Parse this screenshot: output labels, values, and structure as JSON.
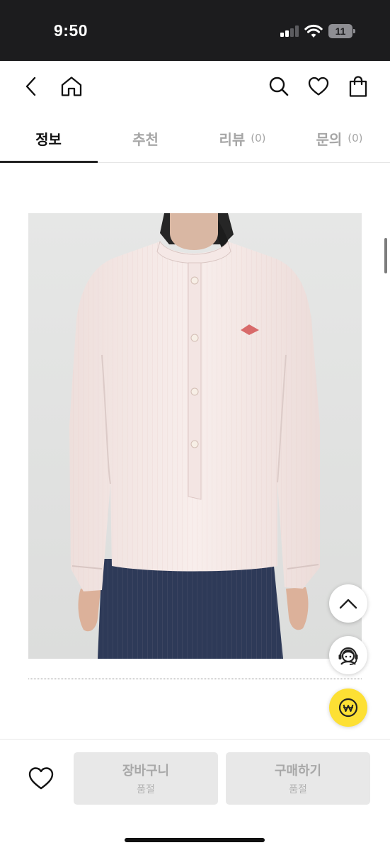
{
  "status_bar": {
    "time": "9:50",
    "battery_level": "11",
    "icons": [
      "cellular-signal-icon",
      "wifi-icon",
      "battery-icon"
    ]
  },
  "header": {
    "icons": [
      "back-arrow-icon",
      "home-icon",
      "search-icon",
      "heart-icon",
      "shopping-bag-icon"
    ]
  },
  "tabs": [
    {
      "label": "정보",
      "count": "",
      "active": true
    },
    {
      "label": "추천",
      "count": ""
    },
    {
      "label": "리뷰",
      "count": "(0)"
    },
    {
      "label": "문의",
      "count": "(0)"
    }
  ],
  "floating_buttons": {
    "icons": [
      "chevron-up-icon",
      "customer-service-icon",
      "won-pay-icon"
    ],
    "pay_color": "#FDE034"
  },
  "bottom_bar": {
    "wish_icon": "heart-outline-icon",
    "cart": {
      "label": "장바구니",
      "sub": "품절"
    },
    "buy": {
      "label": "구매하기",
      "sub": "품절"
    }
  },
  "colors": {
    "status_bar_bg": "#1C1C1E",
    "active_tab": "#111111",
    "inactive_tab": "#A6A6A6",
    "disabled_button_bg": "#E8E8E8"
  }
}
